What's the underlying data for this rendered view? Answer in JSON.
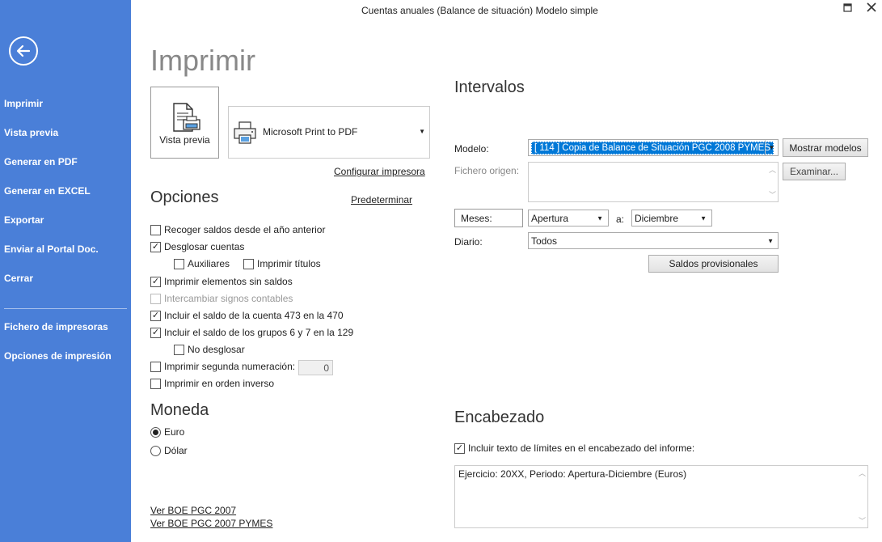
{
  "window": {
    "title": "Cuentas anuales (Balance de situación) Modelo simple",
    "maximize_icon": "maximize-icon",
    "close_icon": "close-icon"
  },
  "sidebar": {
    "back_icon": "arrow-left-icon",
    "items": [
      {
        "label": "Imprimir"
      },
      {
        "label": "Vista previa"
      },
      {
        "label": "Generar en PDF"
      },
      {
        "label": "Generar en EXCEL"
      },
      {
        "label": "Exportar"
      },
      {
        "label": "Enviar al Portal Doc."
      },
      {
        "label": "Cerrar"
      },
      {
        "label": "Fichero de impresoras"
      },
      {
        "label": "Opciones de impresión"
      }
    ],
    "color": "#4a7fd8"
  },
  "main": {
    "title": "Imprimir",
    "preview_button": "Vista previa",
    "printer": {
      "selected": "Microsoft Print to PDF",
      "configure_link": "Configurar impresora"
    },
    "options": {
      "title": "Opciones",
      "default_link": "Predeterminar",
      "items": [
        {
          "label": "Recoger saldos desde el año anterior",
          "checked": false
        },
        {
          "label": "Desglosar cuentas",
          "checked": true
        },
        {
          "label": "Auxiliares",
          "checked": false
        },
        {
          "label": "Imprimir títulos",
          "checked": false
        },
        {
          "label": "Imprimir elementos sin saldos",
          "checked": true
        },
        {
          "label": "Intercambiar signos contables",
          "checked": false,
          "disabled": true
        },
        {
          "label": "Incluir el saldo de la cuenta 473 en la 470",
          "checked": true
        },
        {
          "label": "Incluir el saldo de los grupos 6 y 7 en la 129",
          "checked": true
        },
        {
          "label": "No desglosar",
          "checked": false
        },
        {
          "label": "Imprimir segunda numeración:",
          "checked": false
        },
        {
          "label": "Imprimir en orden inverso",
          "checked": false
        }
      ],
      "second_numbering_value": "0"
    },
    "currency": {
      "title": "Moneda",
      "options": [
        {
          "label": "Euro",
          "selected": true
        },
        {
          "label": "Dólar",
          "selected": false
        }
      ]
    },
    "links": [
      "Ver BOE PGC 2007",
      "Ver BOE PGC 2007 PYMES"
    ]
  },
  "intervals": {
    "title": "Intervalos",
    "model_label": "Modelo:",
    "model_value": "[ 114 ] Copia de Balance de Situación PGC 2008 PYMES",
    "show_models_button": "Mostrar modelos",
    "source_file_label": "Fichero origen:",
    "browse_button": "Examinar...",
    "months_label": "Meses:",
    "month_from": "Apertura",
    "to_label": "a:",
    "month_to": "Diciembre",
    "journal_label": "Diario:",
    "journal_value": "Todos",
    "provisional_button": "Saldos provisionales"
  },
  "header_section": {
    "title": "Encabezado",
    "include_label": "Incluir texto de límites en el encabezado del informe:",
    "include_checked": true,
    "text": "Ejercicio: 20XX, Periodo: Apertura-Diciembre (Euros)"
  },
  "colors": {
    "accent": "#4a7fd8",
    "selection": "#0078d7"
  }
}
